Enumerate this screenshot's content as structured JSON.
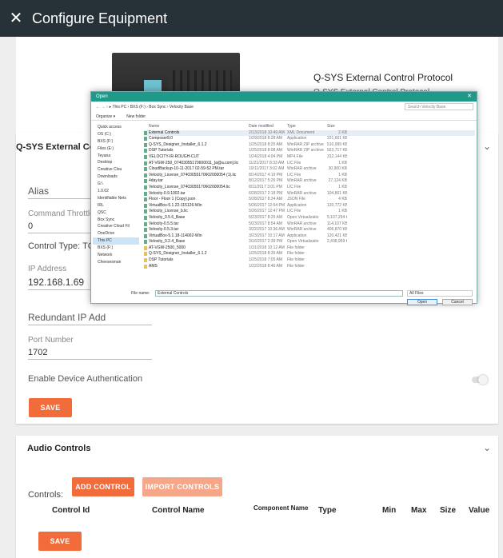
{
  "header": {
    "title": "Configure Equipment",
    "close_glyph": "✕"
  },
  "hero": {
    "product_name": "Q-SYS External Control Protocol",
    "subtitle": "Q-SYS External Control Protocol"
  },
  "external_control": {
    "card_title": "Q-SYS External Cont",
    "alias_label": "Alias",
    "command_throttle_label": "Command Throttle",
    "command_throttle_value": "0",
    "control_type": "Control Type: TCP",
    "ip_label": "IP Address",
    "ip_value": "192.168.1.69",
    "redundant_ip_label": "Redundant IP Add",
    "port_label": "Port Number",
    "port_value": "1702",
    "auth_label": "Enable Device Authentication",
    "save_label": "SAVE"
  },
  "audio_controls": {
    "card_title": "Audio Controls",
    "controls_label": "Controls:",
    "add_label": "ADD CONTROL",
    "import_label": "IMPORT CONTROLS",
    "columns": [
      "Control Id",
      "Control Name",
      "Component Name",
      "Type",
      "Min",
      "Max",
      "Size",
      "Value"
    ],
    "save_label": "SAVE"
  },
  "dialog": {
    "title": "Open",
    "breadcrumb": "← → ↑  ▸ This PC › BXS (F:) › Box Sync › Velocity Base",
    "search_placeholder": "Search Velocity Base",
    "organize_label": "Organize ▾",
    "new_folder_label": "New folder",
    "nav_items": [
      "Quick access",
      "OS (C:)",
      "BXS (F:)",
      "Files (E:)",
      "Teyana",
      "Desktop",
      "Creative Clou",
      "Downloads",
      "G:\\",
      "1.0.02",
      "Identifiable Nets",
      "IRL",
      "QSC",
      "Box Sync",
      "Creative Cloud Fil",
      "OneDrive",
      "This PC",
      "BXS (F:)",
      "Network",
      "Cheesesman"
    ],
    "nav_selected": "This PC",
    "file_columns": [
      "Name",
      "Date modified",
      "Type",
      "Size"
    ],
    "files": [
      {
        "name": "External Controls",
        "date": "2/13/2018 10:49 AM",
        "type": "XML Document",
        "size": "2 KB"
      },
      {
        "name": "Composer8.0",
        "date": "1/29/2018 8:28 AM",
        "type": "Application",
        "size": "221,601 KB"
      },
      {
        "name": "Q-SYS_Designer_Installer_6.1.2",
        "date": "1/25/2018 8:25 AM",
        "type": "WinRAR ZIP archive",
        "size": "510,999 KB"
      },
      {
        "name": "DSP Tutorials",
        "date": "1/25/2018 8:08 AM",
        "type": "WinRAR ZIP archive",
        "size": "923,717 KB"
      },
      {
        "name": "VELOCITY-IR-ROUGH-CUT",
        "date": "1/24/2018 4:04 PM",
        "type": "MP4 File",
        "size": "312,144 KB"
      },
      {
        "name": "AT-VGW-250_07403055170600011_[a@a.com].lic",
        "date": "11/21/2017 8:33 AM",
        "type": "LIC File",
        "size": "1 KB"
      },
      {
        "name": "CloudBackup-10-11-2017 02-59-52 PM.tar",
        "date": "10/11/2017 3:02 AM",
        "type": "WinRAR archive",
        "size": "30,900 KB"
      },
      {
        "name": "Velocity_License_07403055170602000054 (1).lic",
        "date": "8/14/2017 4:19 PM",
        "type": "LIC File",
        "size": "1 KB"
      },
      {
        "name": "4day.tar",
        "date": "8/12/2017 5:26 PM",
        "type": "WinRAR archive",
        "size": "27,124 KB"
      },
      {
        "name": "Velocity_License_07403055170602000054.lic",
        "date": "8/11/2017 3:01 PM",
        "type": "LIC File",
        "size": "1 KB"
      },
      {
        "name": "Velocity-0.9.1002.tar",
        "date": "6/28/2017 2:18 PM",
        "type": "WinRAR archive",
        "size": "104,801 KB"
      },
      {
        "name": "Floor - Floor 1 (Copy).json",
        "date": "5/28/2017 8:34 AM",
        "type": "JSON File",
        "size": "4 KB"
      },
      {
        "name": "VirtualBox-5.1.22-115126-Win",
        "date": "5/26/2017 12:54 PM",
        "type": "Application",
        "size": "120,772 KB"
      },
      {
        "name": "Velocity_License_b.lic",
        "date": "5/26/2017 12:47 PM",
        "type": "LIC File",
        "size": "1 KB"
      },
      {
        "name": "Velocity_0.5.6_Base",
        "date": "5/23/2017 8:25 AM",
        "type": "Open Virtualizatio",
        "size": "5,107,294 KB"
      },
      {
        "name": "Velocity-0.5.5.tar",
        "date": "5/23/2017 8:54 AM",
        "type": "WinRAR archive",
        "size": "114,107 KB"
      },
      {
        "name": "Velocity-0.5.3.tar",
        "date": "3/22/2017 10:36 AM",
        "type": "WinRAR archive",
        "size": "406,870 KB"
      },
      {
        "name": "VirtualBox-5.1.18-114002-Win",
        "date": "3/23/2017 10:17 AM",
        "type": "Application",
        "size": "120,421 KB"
      },
      {
        "name": "Velocity_0.2.4_Base",
        "date": "3/16/2017 2:39 PM",
        "type": "Open Virtualizatio",
        "size": "2,438,959 KB"
      },
      {
        "name": "AT-VGW-2500_5000",
        "date": "1/31/2018 10:12 AM",
        "type": "File folder",
        "size": ""
      },
      {
        "name": "Q-SYS_Designer_Installer_6.1.2",
        "date": "1/25/2018 8:35 AM",
        "type": "File folder",
        "size": ""
      },
      {
        "name": "DSP Tutorials",
        "date": "1/25/2018 7:05 AM",
        "type": "File folder",
        "size": ""
      },
      {
        "name": "AMS",
        "date": "1/22/2018 8:46 AM",
        "type": "File folder",
        "size": ""
      }
    ],
    "filename_label": "File name:",
    "filename_value": "External Controls",
    "filter_value": "All Files",
    "open_label": "Open",
    "cancel_label": "Cancel"
  },
  "colors": {
    "topbar": "#263238",
    "accent": "#f26b3a",
    "accent_light": "#f6a78a",
    "dialog_title": "#1f9a8a"
  }
}
